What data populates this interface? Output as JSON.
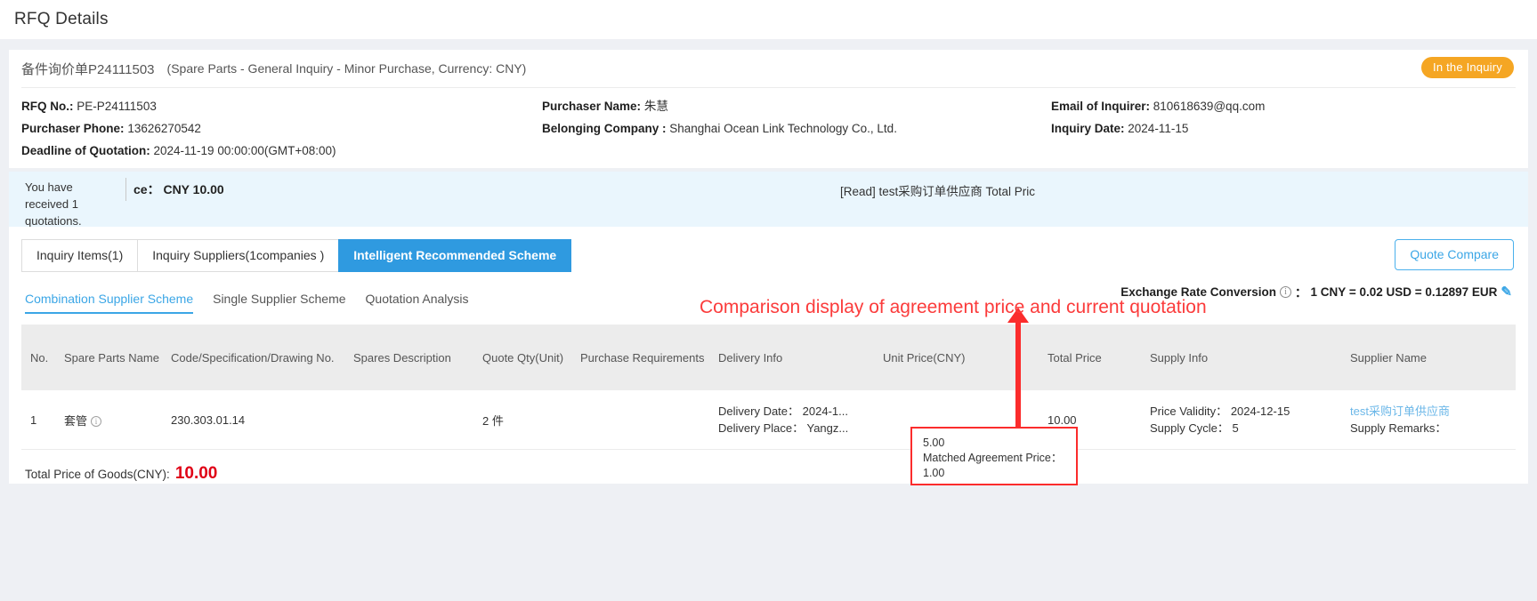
{
  "header": {
    "page_title": "RFQ Details"
  },
  "rfq": {
    "title_cn": "备件询价单P24111503",
    "title_en": "(Spare Parts - General Inquiry - Minor Purchase, Currency: CNY)",
    "status_badge": "In the Inquiry",
    "fields": {
      "rfq_no_label": "RFQ No.:",
      "rfq_no_value": "PE-P24111503",
      "purchaser_name_label": "Purchaser Name:",
      "purchaser_name_value": "朱慧",
      "email_label": "Email of Inquirer:",
      "email_value": "810618639@qq.com",
      "purchaser_phone_label": "Purchaser Phone:",
      "purchaser_phone_value": "13626270542",
      "belonging_company_label": "Belonging Company :",
      "belonging_company_value": "Shanghai Ocean Link Technology Co., Ltd.",
      "inquiry_date_label": "Inquiry Date:",
      "inquiry_date_value": "2024-11-15",
      "deadline_label": "Deadline of Quotation:",
      "deadline_value": "2024-11-19 00:00:00(GMT+08:00)"
    }
  },
  "banner": {
    "left_text": "You have received 1 quotations.",
    "mid_text": "ce： CNY 10.00",
    "right_text": "[Read] test采购订单供应商 Total Pric"
  },
  "tabs": [
    {
      "label": "Inquiry Items(1)",
      "active": false
    },
    {
      "label": "Inquiry Suppliers(1companies )",
      "active": false
    },
    {
      "label": "Intelligent Recommended Scheme",
      "active": true
    }
  ],
  "toolbar": {
    "quote_compare_label": "Quote Compare"
  },
  "exchange_rate": {
    "label": "Exchange Rate Conversion",
    "info_glyph": "i",
    "separator": "：",
    "value": "1 CNY = 0.02 USD = 0.12897 EUR",
    "edit_glyph": "✎"
  },
  "subtabs": [
    {
      "label": "Combination Supplier Scheme",
      "active": true
    },
    {
      "label": "Single Supplier Scheme",
      "active": false
    },
    {
      "label": "Quotation Analysis",
      "active": false
    }
  ],
  "table": {
    "columns": [
      "No.",
      "Spare Parts Name",
      "Code/Specification/Drawing No.",
      "Spares Description",
      "Quote Qty(Unit)",
      "Purchase Requirements",
      "Delivery Info",
      "Unit Price(CNY)",
      "Total Price",
      "Supply Info",
      "Supplier Name"
    ],
    "rows": [
      {
        "no": "1",
        "spare_parts_name": "套管",
        "code": "230.303.01.14",
        "spares_description": "",
        "quote_qty": "2 件",
        "purchase_requirements": "",
        "delivery_date_label": "Delivery Date：",
        "delivery_date_value": "2024-1...",
        "delivery_place_label": "Delivery Place：",
        "delivery_place_value": "Yangz...",
        "unit_price": "5.00",
        "matched_agreement_price_label": "Matched Agreement Price：",
        "matched_agreement_price_value": "1.00",
        "total_price": "10.00",
        "price_validity_label": "Price Validity：",
        "price_validity_value": "2024-12-15",
        "supply_cycle_label": "Supply Cycle：",
        "supply_cycle_value": "5",
        "supplier_name": "test采购订单供应商",
        "supply_remarks_label": "Supply Remarks："
      }
    ]
  },
  "total": {
    "label": "Total Price of Goods(CNY):",
    "amount": "10.00"
  },
  "annotation": {
    "text": "Comparison display of agreement price and current quotation"
  },
  "colors": {
    "accent_blue": "#3ba6e6",
    "status_orange": "#f5a623",
    "annotation_red": "#fb3b3b",
    "total_red": "#e00016",
    "banner_bg": "#eaf6fd"
  }
}
